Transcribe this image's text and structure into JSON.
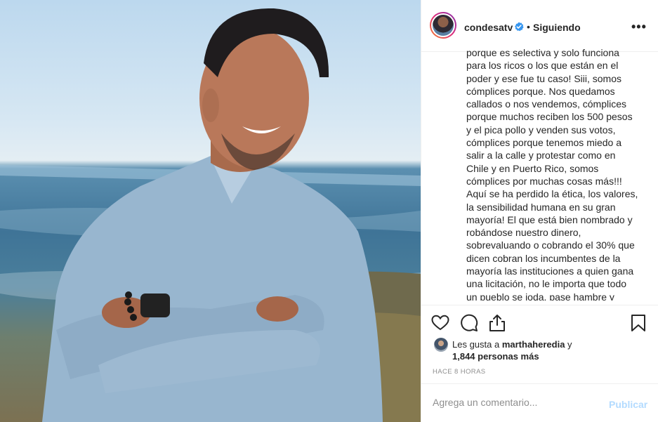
{
  "post": {
    "username": "condesatv",
    "separator": "•",
    "follow_status": "Siguiendo",
    "more_icon": "•••",
    "caption_lines": [
      "porque es selectiva y solo funciona",
      "para los ricos o los que están en el",
      "poder y ese fue tu caso! Siii, somos",
      "cómplices porque. Nos quedamos",
      "callados o nos vendemos, cómplices",
      "porque muchos reciben los 500 pesos",
      "y el pica pollo y venden sus votos,",
      "cómplices porque tenemos miedo a",
      "salir a la calle y protestar como en",
      "Chile y en Puerto Rico, somos",
      "cómplices por muchas cosas más!!!",
      "Aquí se ha perdido la ética, los valores,",
      "la sensibilidad humana en su gran",
      "mayoría! El que está bien nombrado y",
      "robándose nuestro dinero,",
      "sobrevaluando o cobrando el 30% que",
      "dicen cobran los incumbentes de la",
      "mayoría las instituciones a quien gana",
      "una licitación, no le importa que todo",
      "un pueblo se joda, pase hambre y"
    ],
    "likes": {
      "prefix": "Les gusta a ",
      "user": "marthaheredia",
      "suffix": " y",
      "others": "1,844 personas más"
    },
    "timestamp": "HACE 8 HORAS",
    "comment": {
      "placeholder": "Agrega un comentario...",
      "value": "",
      "publish_label": "Publicar"
    },
    "icons": [
      "heart-icon",
      "comment-icon",
      "share-icon",
      "bookmark-icon",
      "verified-badge-icon",
      "more-options-icon"
    ],
    "colors": {
      "verified": "#3897f0",
      "publish_disabled": "#b3dbff",
      "muted": "#8e8e8e",
      "text": "#262626"
    }
  }
}
